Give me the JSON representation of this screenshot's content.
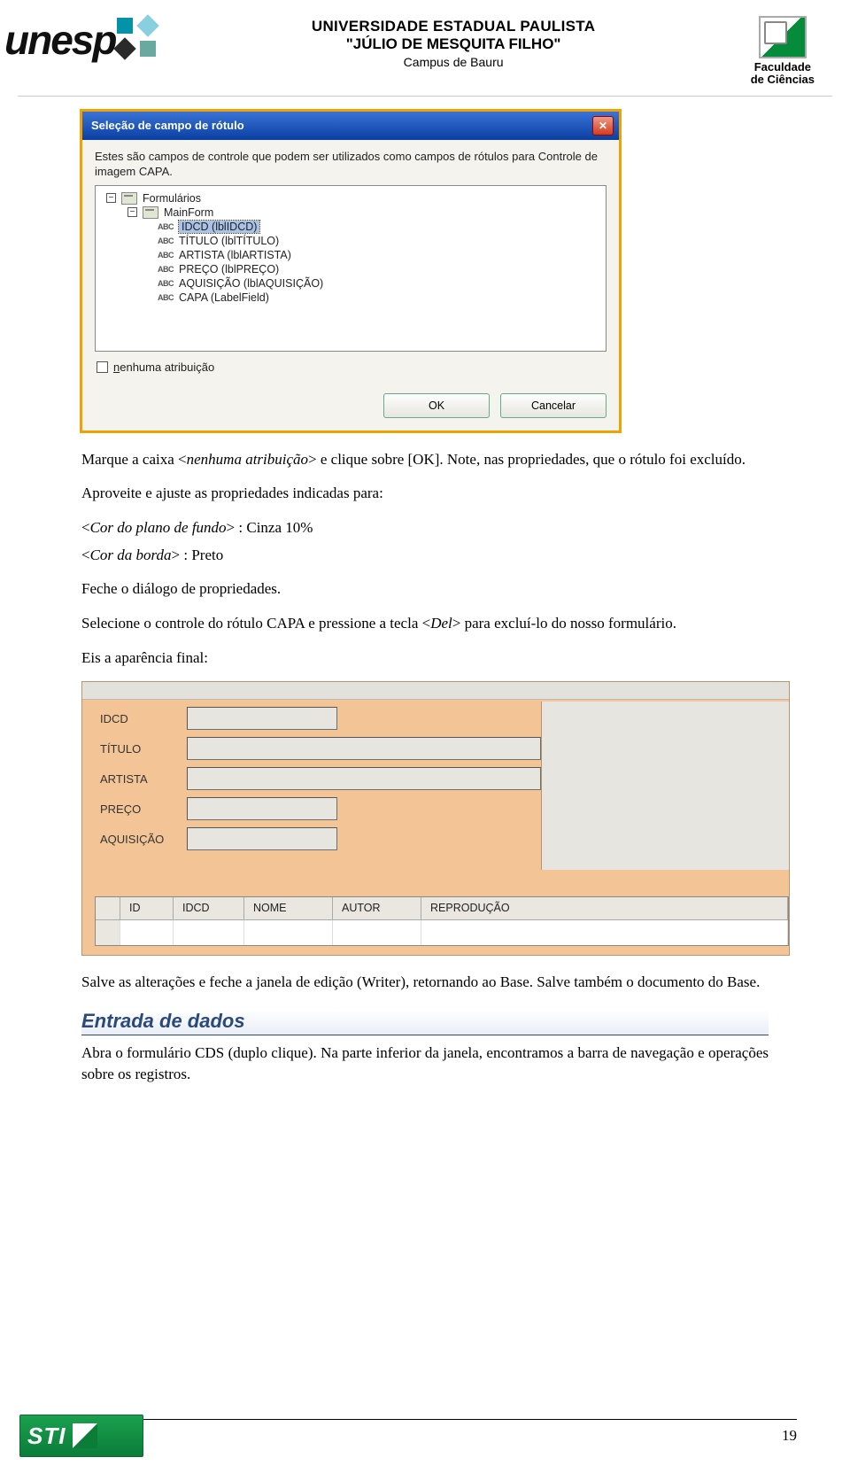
{
  "header": {
    "logo_word": "unesp",
    "center_line1": "UNIVERSIDADE ESTADUAL PAULISTA",
    "center_line2": "\"JÚLIO DE MESQUITA FILHO\"",
    "center_line3": "Campus de Bauru",
    "facc_line1": "Faculdade",
    "facc_line2": "de Ciências"
  },
  "dialog": {
    "title": "Seleção de campo de rótulo",
    "message": "Estes são campos de controle que podem ser utilizados como campos de rótulos para Controle de imagem CAPA.",
    "tree_root": "Formulários",
    "tree_form": "MainForm",
    "tree_items": [
      "IDCD (lblIDCD)",
      "TÍTULO (lblTÍTULO)",
      "ARTISTA (lblARTISTA)",
      "PREÇO (lblPREÇO)",
      "AQUISIÇÃO (lblAQUISIÇÃO)",
      "CAPA (LabelField)"
    ],
    "checkbox_pre": "n",
    "checkbox_rest": "enhuma atribuição",
    "ok_label": "OK",
    "cancel_label": "Cancelar"
  },
  "text": {
    "p1a": "Marque a caixa <",
    "p1b": "nenhuma atribuição",
    "p1c": "> e clique sobre [OK]. Note, nas propriedades, que o rótulo foi excluído.",
    "p2": "Aproveite e ajuste as propriedades indicadas para:",
    "p3a": "<",
    "p3b": "Cor do plano de fundo",
    "p3c": "> : Cinza 10%",
    "p4a": "<",
    "p4b": "Cor da borda",
    "p4c": "> : Preto",
    "p5": "Feche o diálogo de propriedades.",
    "p6a": "Selecione o controle do rótulo CAPA e pressione a tecla <",
    "p6b": "Del",
    "p6c": "> para excluí-lo do nosso formulário.",
    "p7": "Eis a aparência final:",
    "p8": "Salve as alterações e feche a janela de edição (Writer), retornando ao Base. Salve também o documento do Base.",
    "p9": "Abra o formulário CDS (duplo clique). Na parte inferior da janela, encontramos a barra de navegação e operações sobre os registros."
  },
  "form_preview": {
    "labels": [
      "IDCD",
      "TÍTULO",
      "ARTISTA",
      "PREÇO",
      "AQUISIÇÃO"
    ],
    "grid_headers": [
      "ID",
      "IDCD",
      "NOME",
      "AUTOR",
      "REPRODUÇÃO"
    ]
  },
  "section_heading": "Entrada de dados",
  "footer": {
    "sti_label": "STI",
    "page_number": "19"
  }
}
